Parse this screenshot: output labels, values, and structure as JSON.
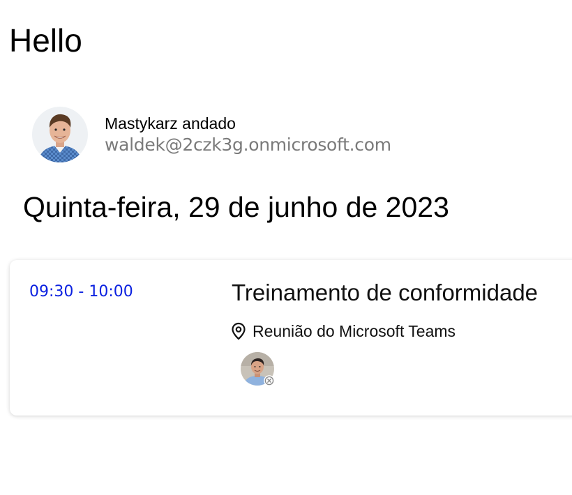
{
  "header": {
    "greeting": "Hello"
  },
  "profile": {
    "name": "Mastykarz andado",
    "email": "waldek@2czk3g.onmicrosoft.com"
  },
  "agenda": {
    "date": "Quinta-feira, 29 de junho de 2023",
    "events": [
      {
        "time": "09:30 - 10:00",
        "title": "Treinamento de conformidade",
        "location": "Reunião do Microsoft Teams",
        "location_icon": "location-pin-icon",
        "attendee_status_icon": "declined-status-icon"
      }
    ]
  },
  "colors": {
    "time_text": "#0b21e0",
    "email_text": "#7a7a7a"
  }
}
